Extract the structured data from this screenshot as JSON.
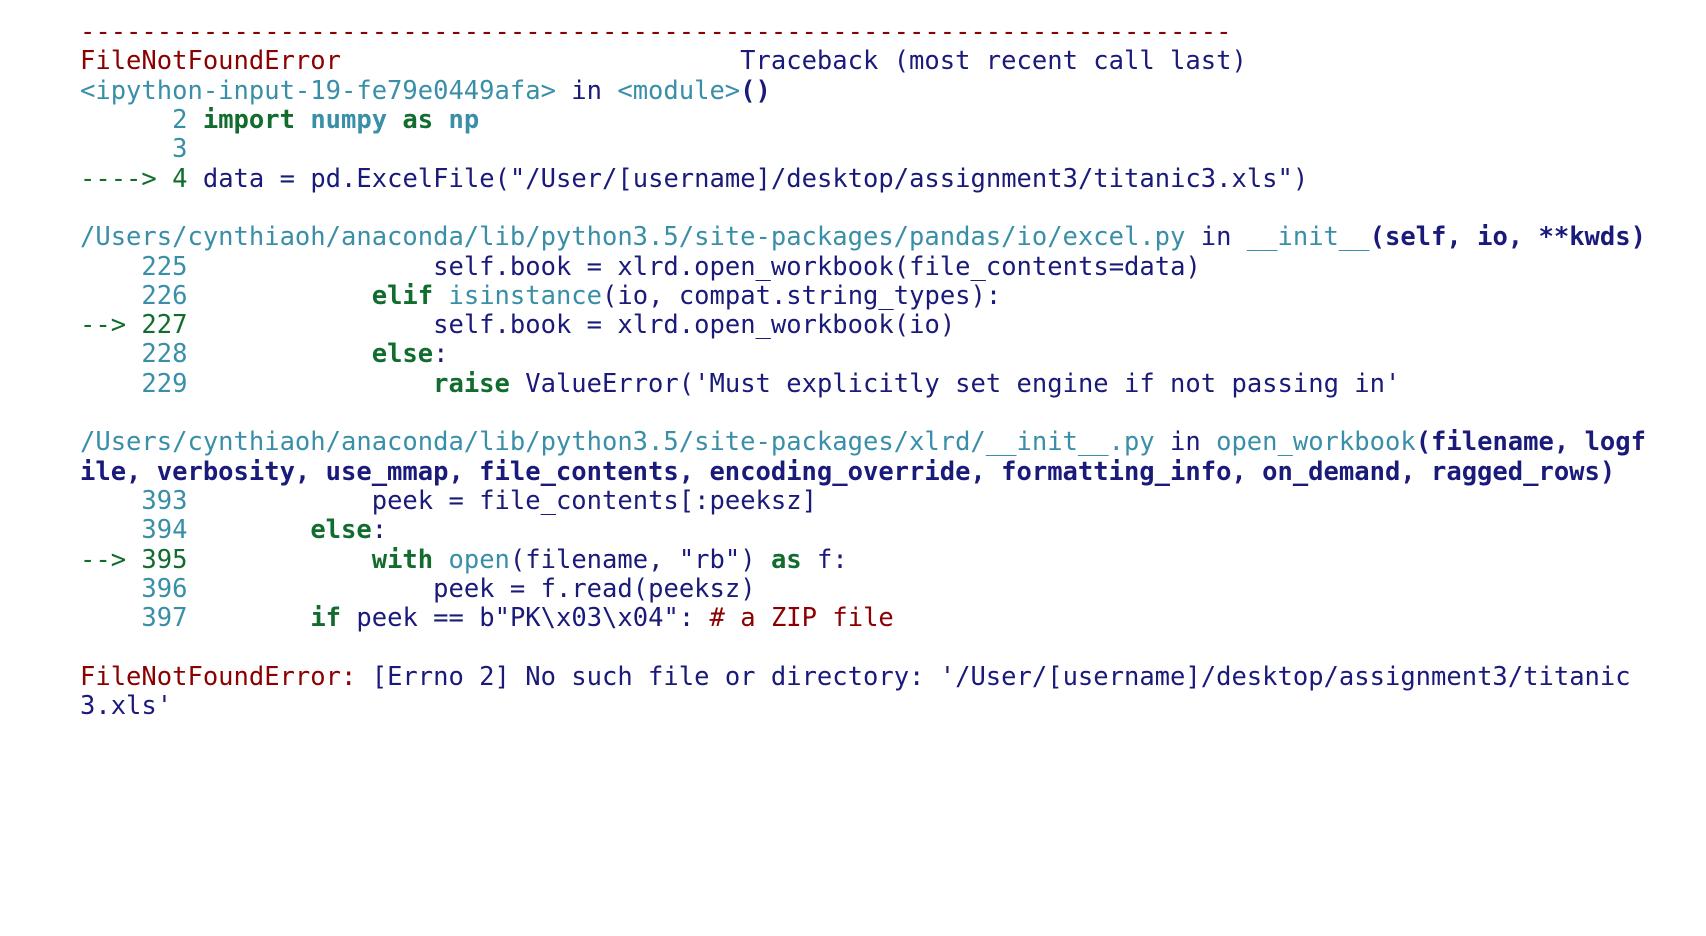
{
  "header": {
    "divider": "---------------------------------------------------------------------------",
    "error_name": "FileNotFoundError",
    "error_gap": "                          ",
    "traceback_label": "Traceback (most recent call last)"
  },
  "frame0": {
    "loc_cyan": "<ipython-input-19-fe79e0449afa>",
    "in_": " in ",
    "func": "<module>",
    "sig": "()",
    "l2_pre": "      ",
    "l2_num": "2",
    "l2_kw": " import ",
    "l2_mod": "numpy",
    "l2_as": " as ",
    "l2_alias": "np",
    "l3_pre": "      ",
    "l3_num": "3",
    "l3_rest": " ",
    "l4_arrow": "----> ",
    "l4_num": "4",
    "l4_code_a": " data ",
    "l4_eq": "=",
    "l4_code_b": " pd",
    "l4_dot1": ".",
    "l4_call": "ExcelFile",
    "l4_op": "(",
    "l4_str": "\"/User/[username]/desktop/assignment3/titanic3.xls\"",
    "l4_cp": ")"
  },
  "frame1": {
    "path": "/Users/cynthiaoh/anaconda/lib/python3.5/site-packages/pandas/io/excel.py",
    "in_": " in ",
    "func": "__init__",
    "sig": "(self, io, **kwds)",
    "l225_pre": "    ",
    "l225_num": "225",
    "l225_a": "                self",
    "l225_b": ".",
    "l225_c": "book ",
    "l225_d": "=",
    "l225_e": " xlrd",
    "l225_f": ".",
    "l225_g": "open_workbook",
    "l225_h": "(",
    "l225_i": "file_contents",
    "l225_j": "=",
    "l225_k": "data",
    "l225_l": ")",
    "l226_pre": "    ",
    "l226_num": "226",
    "l226_a": "            ",
    "l226_b": "elif",
    "l226_c": " isinstance",
    "l226_d": "(",
    "l226_e": "io",
    "l226_f": ",",
    "l226_g": " compat",
    "l226_h": ".",
    "l226_i": "string_types",
    "l226_j": "):",
    "l227_arrow": "--> ",
    "l227_num": "227",
    "l227_a": "                self",
    "l227_b": ".",
    "l227_c": "book ",
    "l227_d": "=",
    "l227_e": " xlrd",
    "l227_f": ".",
    "l227_g": "open_workbook",
    "l227_h": "(",
    "l227_i": "io",
    "l227_j": ")",
    "l228_pre": "    ",
    "l228_num": "228",
    "l228_a": "            ",
    "l228_b": "else",
    "l228_c": ":",
    "l229_pre": "    ",
    "l229_num": "229",
    "l229_a": "                ",
    "l229_b": "raise",
    "l229_c": " ValueError",
    "l229_d": "(",
    "l229_e": "'Must explicitly set engine if not passing in'"
  },
  "frame2": {
    "path": "/Users/cynthiaoh/anaconda/lib/python3.5/site-packages/xlrd/__init__.py",
    "in_": " in ",
    "func": "open_workbook",
    "sig": "(filename, logfile, verbosity, use_mmap, file_contents, encoding_override, formatting_info, on_demand, ragged_rows)",
    "l393_pre": "    ",
    "l393_num": "393",
    "l393_a": "            peek ",
    "l393_b": "=",
    "l393_c": " file_contents",
    "l393_d": "[:",
    "l393_e": "peeksz",
    "l393_f": "]",
    "l394_pre": "    ",
    "l394_num": "394",
    "l394_a": "        ",
    "l394_b": "else",
    "l394_c": ":",
    "l395_arrow": "--> ",
    "l395_num": "395",
    "l395_a": "            ",
    "l395_b": "with",
    "l395_c": " open",
    "l395_d": "(",
    "l395_e": "filename",
    "l395_f": ",",
    "l395_g": " ",
    "l395_h": "\"rb\"",
    "l395_i": ")",
    "l395_j": " ",
    "l395_k": "as",
    "l395_l": " f",
    "l395_m": ":",
    "l396_pre": "    ",
    "l396_num": "396",
    "l396_a": "                peek ",
    "l396_b": "=",
    "l396_c": " f",
    "l396_d": ".",
    "l396_e": "read",
    "l396_f": "(",
    "l396_g": "peeksz",
    "l396_h": ")",
    "l397_pre": "    ",
    "l397_num": "397",
    "l397_a": "        ",
    "l397_b": "if",
    "l397_c": " peek ",
    "l397_d": "==",
    "l397_e": " b",
    "l397_f": "\"PK\\x03\\x04\"",
    "l397_g": ":",
    "l397_h": " # a ZIP file"
  },
  "final": {
    "err": "FileNotFoundError",
    "colon": ": ",
    "msg": "[Errno 2] No such file or directory: '/User/[username]/desktop/assignment3/titanic3.xls'"
  }
}
